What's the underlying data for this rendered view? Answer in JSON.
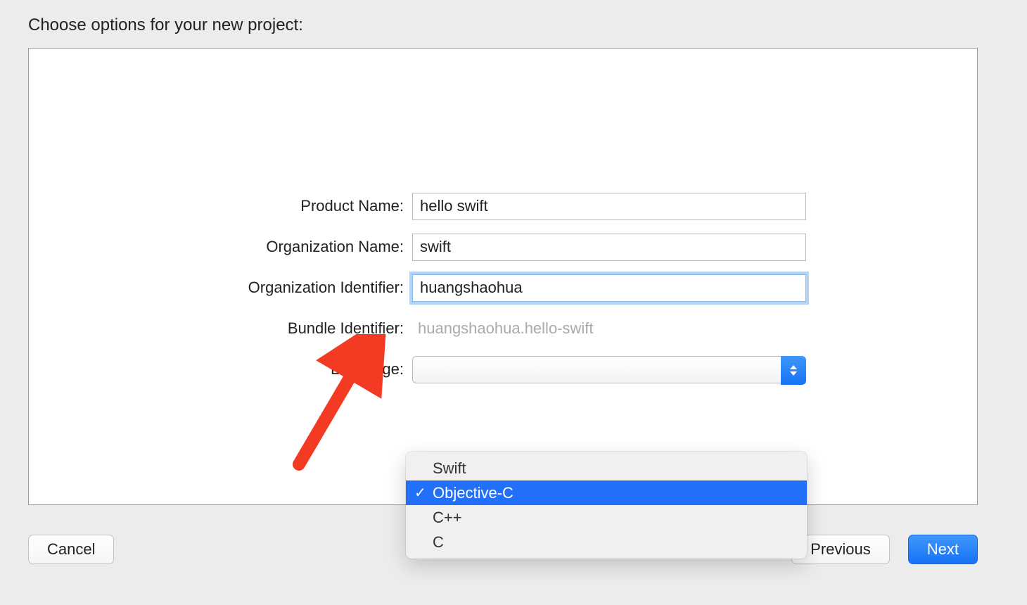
{
  "title": "Choose options for your new project:",
  "form": {
    "productName": {
      "label": "Product Name:",
      "value": "hello swift"
    },
    "orgName": {
      "label": "Organization Name:",
      "value": "swift"
    },
    "orgIdentifier": {
      "label": "Organization Identifier:",
      "value": "huangshaohua"
    },
    "bundleIdentifier": {
      "label": "Bundle Identifier:",
      "value": "huangshaohua.hello-swift"
    },
    "language": {
      "label": "Language:"
    }
  },
  "languageMenu": {
    "options": [
      "Swift",
      "Objective-C",
      "C++",
      "C"
    ],
    "selected": "Objective-C"
  },
  "buttons": {
    "cancel": "Cancel",
    "previous": "Previous",
    "next": "Next"
  }
}
